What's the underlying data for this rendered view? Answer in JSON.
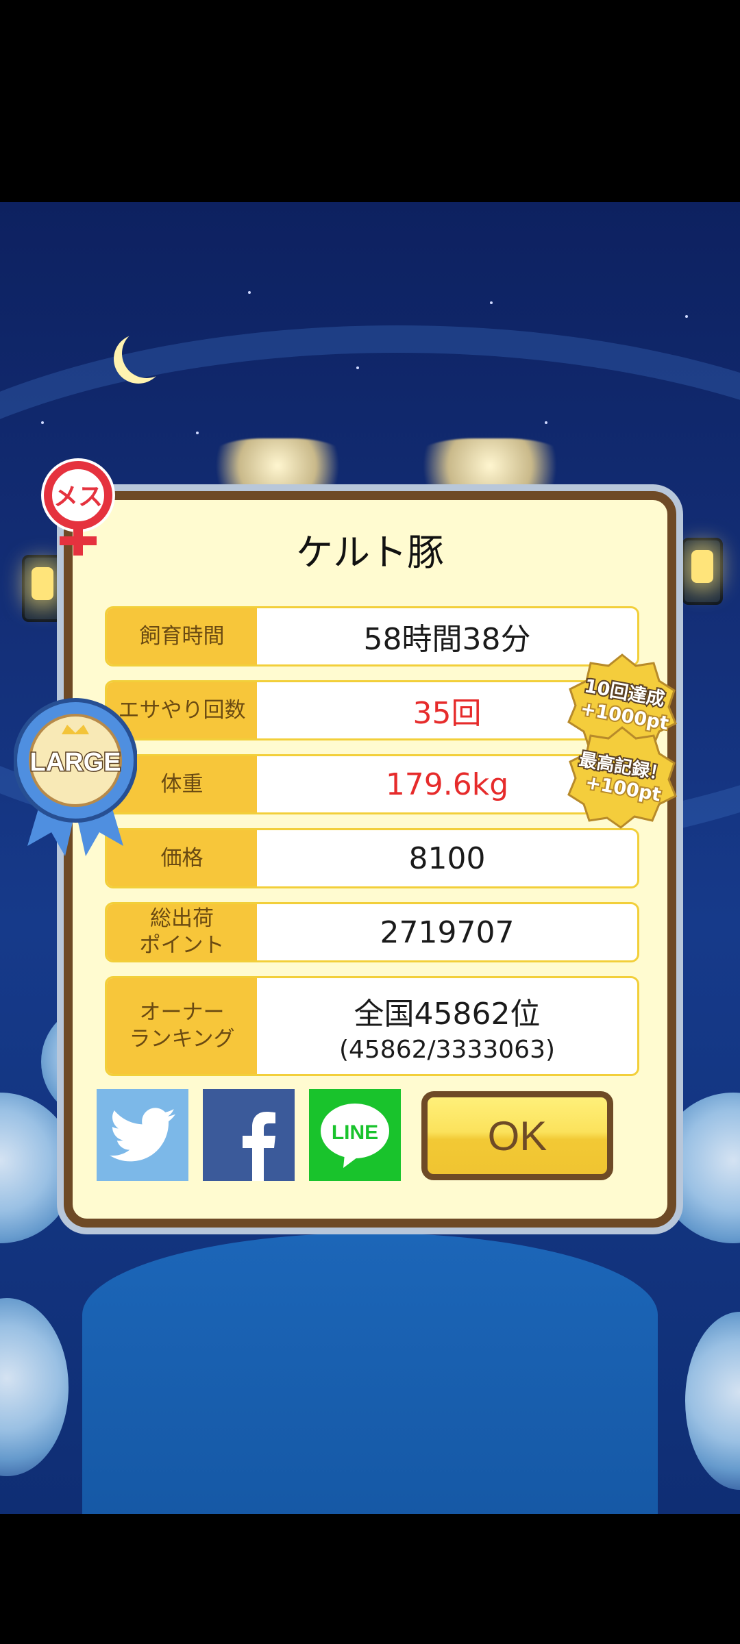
{
  "title": "ケルト豚",
  "rows": [
    {
      "label": "飼育時間",
      "value": "58時間38分",
      "highlight": false
    },
    {
      "label": "エサやり回数",
      "value": "35回",
      "highlight": true
    },
    {
      "label": "体重",
      "value": "179.6kg",
      "highlight": true
    },
    {
      "label": "価格",
      "value": "8100",
      "highlight": false
    },
    {
      "label": "総出荷\nポイント",
      "value": "2719707",
      "highlight": false
    },
    {
      "label": "オーナー\nランキング",
      "value": "全国45862位",
      "sub": "(45862/3333063)",
      "highlight": false
    }
  ],
  "gender_badge": "メス",
  "size_ribbon": "LARGE",
  "bonus_badges": [
    {
      "line1": "10回達成",
      "line2": "+1000pt"
    },
    {
      "line1": "最高記録！",
      "line2": "+100pt"
    }
  ],
  "share": {
    "line_label": "LINE"
  },
  "ok_label": "OK",
  "colors": {
    "accent_red": "#e62b2b",
    "label_bg": "#f7c63a",
    "dialog_bg": "#fffbd0",
    "frame": "#6e4a26"
  }
}
